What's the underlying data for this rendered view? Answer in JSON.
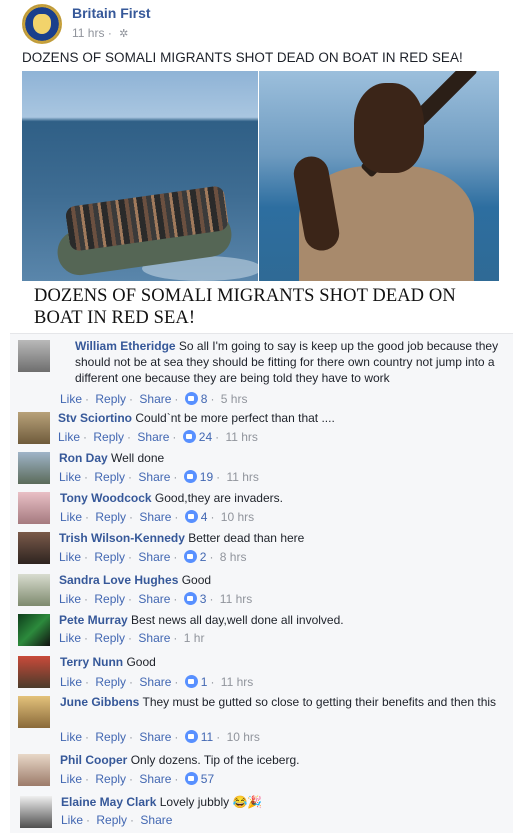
{
  "post": {
    "page_name": "Britain First",
    "time": "11 hrs",
    "separator": "·",
    "text": "DOZENS OF SOMALI MIGRANTS SHOT DEAD ON BOAT IN RED SEA!",
    "headline": "DOZENS OF SOMALI MIGRANTS SHOT DEAD ON BOAT IN RED SEA!"
  },
  "labels": {
    "like": "Like",
    "reply": "Reply",
    "share": "Share",
    "dot": "·"
  },
  "comments": [
    {
      "author": "William Etheridge",
      "text": "So all I'm going to say is keep up the good job because they should not be at sea they should be fitting for there own country not jump into a different one because they are being told they have to work",
      "likes": "8",
      "time": "5 hrs"
    },
    {
      "author": "Stv Sciortino",
      "text": "Could`nt be more perfect than that ....",
      "likes": "24",
      "time": "11 hrs"
    },
    {
      "author": "Ron Day",
      "text": "Well done",
      "likes": "19",
      "time": "11 hrs"
    },
    {
      "author": "Tony Woodcock",
      "text": "Good,they are invaders.",
      "likes": "4",
      "time": "10 hrs"
    },
    {
      "author": "Trish Wilson-Kennedy",
      "text": "Better dead than here",
      "likes": "2",
      "time": "8 hrs"
    },
    {
      "author": "Sandra Love Hughes",
      "text": "Good",
      "likes": "3",
      "time": "11 hrs"
    },
    {
      "author": "Pete Murray",
      "text": "Best news all day,well done all involved.",
      "likes": "",
      "time": "1 hr"
    },
    {
      "author": "Terry Nunn",
      "text": "Good",
      "likes": "1",
      "time": "11 hrs"
    },
    {
      "author": "June Gibbens",
      "text": "They must be gutted so close to getting their benefits and then this",
      "likes": "11",
      "time": "10 hrs"
    },
    {
      "author": "Phil Cooper",
      "text": "Only dozens. Tip of the iceberg.",
      "likes": "57",
      "time": ""
    },
    {
      "author": "Elaine May Clark",
      "text": "Lovely jubbly 😂🎉",
      "likes": "",
      "time": ""
    }
  ],
  "colors": {
    "link": "#365899",
    "action": "#4267b2",
    "meta": "#90949c",
    "like_badge": "#5890ff"
  },
  "icons": [
    "globe-icon",
    "like-badge-icon",
    "page-avatar"
  ]
}
